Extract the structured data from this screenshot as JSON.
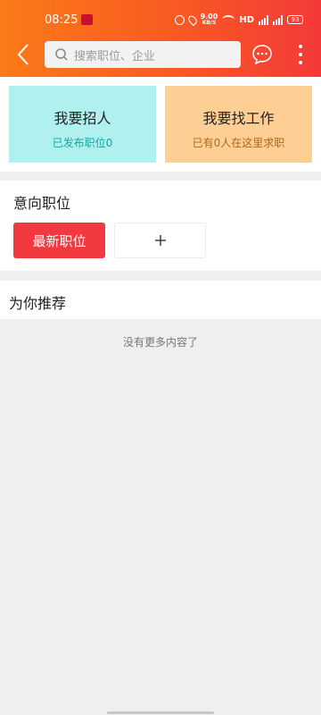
{
  "status_bar": {
    "time": "08:25",
    "net_speed_value": "9.00",
    "net_speed_unit": "KB/S",
    "hd": "HD",
    "battery": "93"
  },
  "header": {
    "search_placeholder": "搜索职位、企业",
    "icons": [
      "back-arrow-icon",
      "search-icon",
      "chat-bubble-icon",
      "more-vertical-icon"
    ]
  },
  "cards": {
    "recruit": {
      "title": "我要招人",
      "subtitle": "已发布职位0"
    },
    "job": {
      "title": "我要找工作",
      "subtitle": "已有0人在这里求职"
    }
  },
  "intent": {
    "title": "意向职位",
    "latest_label": "最新职位",
    "add_symbol": "+"
  },
  "recommend": {
    "title": "为你推荐",
    "empty_text": "没有更多内容了"
  },
  "colors": {
    "header_gradient_start": "#fb7a17",
    "header_gradient_end": "#f4393a",
    "recruit_card": "#b0f1ef",
    "job_card": "#fecf95",
    "latest_button": "#f2393f"
  }
}
